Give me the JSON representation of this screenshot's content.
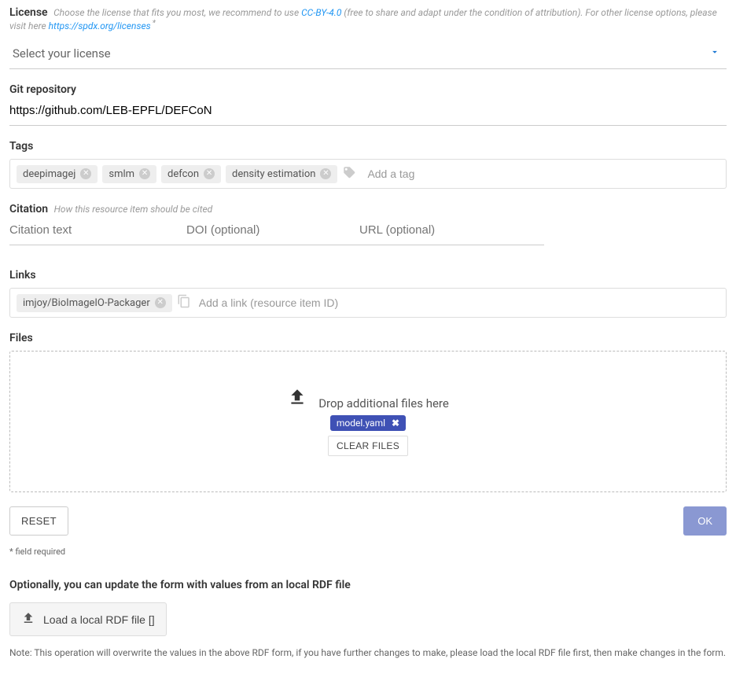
{
  "license": {
    "label": "License",
    "hint_prefix": "Choose the license that fits you most, we recommend to use ",
    "hint_link1_text": "CC-BY-4.0",
    "hint_middle": " (free to share and adapt under the condition of attribution). For other license options, please visit here ",
    "hint_link2_text": "https://spdx.org/licenses",
    "required_mark": "*",
    "select_placeholder": "Select your license"
  },
  "git": {
    "label": "Git repository",
    "value": "https://github.com/LEB-EPFL/DEFCoN"
  },
  "tags": {
    "label": "Tags",
    "items": [
      "deepimagej",
      "smlm",
      "defcon",
      "density estimation"
    ],
    "placeholder": "Add a tag"
  },
  "citation": {
    "label": "Citation",
    "hint": "How this resource item should be cited",
    "text_placeholder": "Citation text",
    "doi_placeholder": "DOI (optional)",
    "url_placeholder": "URL (optional)"
  },
  "links": {
    "label": "Links",
    "item": "imjoy/BioImageIO-Packager",
    "placeholder": "Add a link (resource item ID)"
  },
  "files": {
    "label": "Files",
    "drop_text": "Drop additional files here",
    "file_name": "model.yaml",
    "clear_btn": "CLEAR FILES"
  },
  "actions": {
    "reset": "RESET",
    "ok": "OK"
  },
  "footnote": "* field required",
  "optional_heading": "Optionally, you can update the form with values from an local RDF file",
  "load_rdf_btn": "Load a local RDF file []",
  "note": "Note: This operation will overwrite the values in the above RDF form, if you have further changes to make, please load the local RDF file first, then make changes in the form."
}
